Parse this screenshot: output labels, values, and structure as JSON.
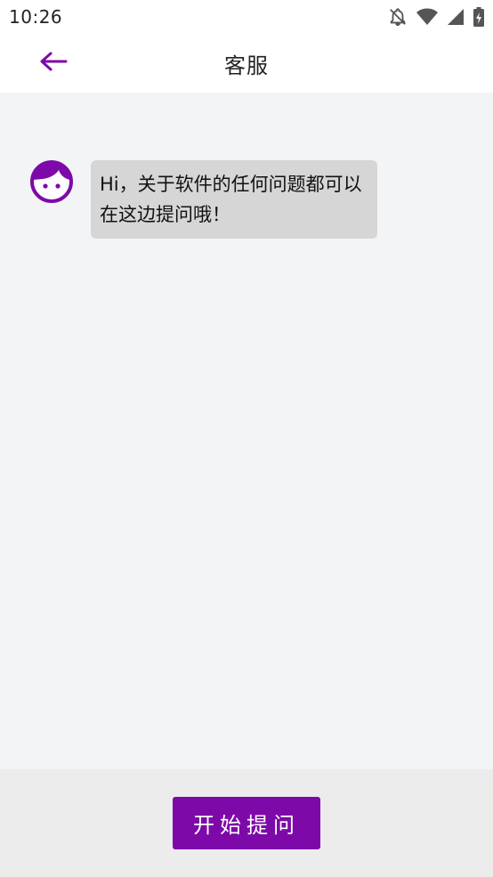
{
  "status_bar": {
    "time": "10:26",
    "icons": [
      "notifications-off-icon",
      "wifi-icon",
      "cellular-signal-icon",
      "battery-charging-icon"
    ]
  },
  "app_bar": {
    "back_icon": "arrow-left-icon",
    "title": "客服"
  },
  "chat": {
    "messages": [
      {
        "sender": "agent",
        "avatar_icon": "face-avatar-icon",
        "text": "Hi，关于软件的任何问题都可以在这边提问哦！"
      }
    ]
  },
  "bottom": {
    "ask_button_label": "开始提问"
  },
  "colors": {
    "accent": "#7d0aa8",
    "bubble": "#d6d6d6",
    "background": "#f3f4f6",
    "bottom_bar": "#ececec"
  }
}
